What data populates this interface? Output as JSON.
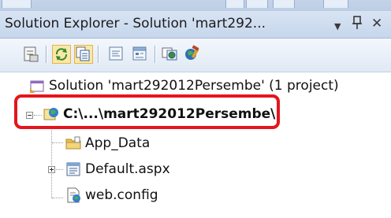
{
  "panel": {
    "title": "Solution Explorer - Solution 'mart292...",
    "dropdown_glyph": "▼",
    "pin_glyph": "ꟷ",
    "close_glyph": "✕"
  },
  "toolbar": {
    "buttons": [
      {
        "name": "properties-icon",
        "pressed": false
      },
      {
        "name": "refresh-icon",
        "pressed": true
      },
      {
        "name": "show-all-files-icon",
        "pressed": true
      },
      {
        "name": "view-code-icon",
        "pressed": false
      },
      {
        "name": "view-designer-icon",
        "pressed": false
      },
      {
        "name": "copy-website-icon",
        "pressed": false
      },
      {
        "name": "aspnet-configuration-icon",
        "pressed": false
      }
    ]
  },
  "tree": {
    "solution_label": "Solution 'mart292012Persembe' (1 project)",
    "project_label": "C:\\...\\mart292012Persembe\\",
    "items": [
      {
        "label": "App_Data",
        "icon": "folder-icon"
      },
      {
        "label": "Default.aspx",
        "icon": "aspx-page-icon"
      },
      {
        "label": "web.config",
        "icon": "config-file-icon"
      }
    ]
  },
  "colors": {
    "highlight": "#e5151b",
    "title_bg": "#d8e4f3"
  }
}
